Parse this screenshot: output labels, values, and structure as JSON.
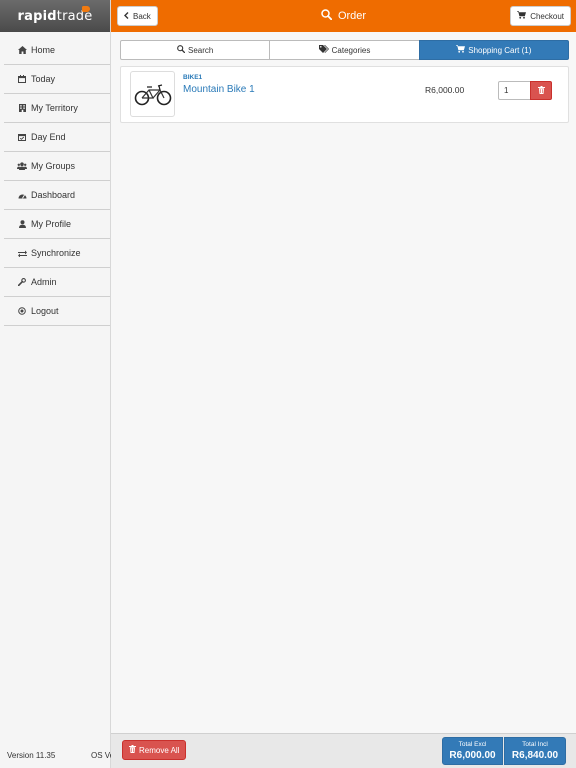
{
  "app": {
    "logo_bold": "rapid",
    "logo_light": "trade",
    "version": "Version 11.35",
    "os_version": "OS Ve"
  },
  "sidebar": {
    "items": [
      {
        "label": "Home",
        "icon": "home-icon"
      },
      {
        "label": "Today",
        "icon": "calendar-icon"
      },
      {
        "label": "My Territory",
        "icon": "building-icon"
      },
      {
        "label": "Day End",
        "icon": "calendar-check-icon"
      },
      {
        "label": "My Groups",
        "icon": "users-icon"
      },
      {
        "label": "Dashboard",
        "icon": "dashboard-icon"
      },
      {
        "label": "My Profile",
        "icon": "user-icon"
      },
      {
        "label": "Synchronize",
        "icon": "exchange-icon"
      },
      {
        "label": "Admin",
        "icon": "wrench-icon"
      },
      {
        "label": "Logout",
        "icon": "logout-icon"
      }
    ]
  },
  "header": {
    "back_label": "Back",
    "title": "Order",
    "checkout_label": "Checkout"
  },
  "tabs": [
    {
      "label": "Search",
      "icon": "search-icon",
      "active": false
    },
    {
      "label": "Categories",
      "icon": "tags-icon",
      "active": false
    },
    {
      "label": "Shopping Cart (1)",
      "icon": "cart-icon",
      "active": true
    }
  ],
  "cart": {
    "items": [
      {
        "code": "BIKE1",
        "name": "Mountain Bike 1",
        "price": "R6,000.00",
        "quantity": "1"
      }
    ]
  },
  "footer": {
    "remove_all_label": "Remove All",
    "total_excl_label": "Total Excl",
    "total_excl_value": "R6,000.00",
    "total_incl_label": "Total Incl",
    "total_incl_value": "R6,840.00"
  },
  "colors": {
    "header": "#ef6c00",
    "primary": "#337ab7",
    "danger": "#d9534f",
    "link": "#2a7ab8"
  }
}
